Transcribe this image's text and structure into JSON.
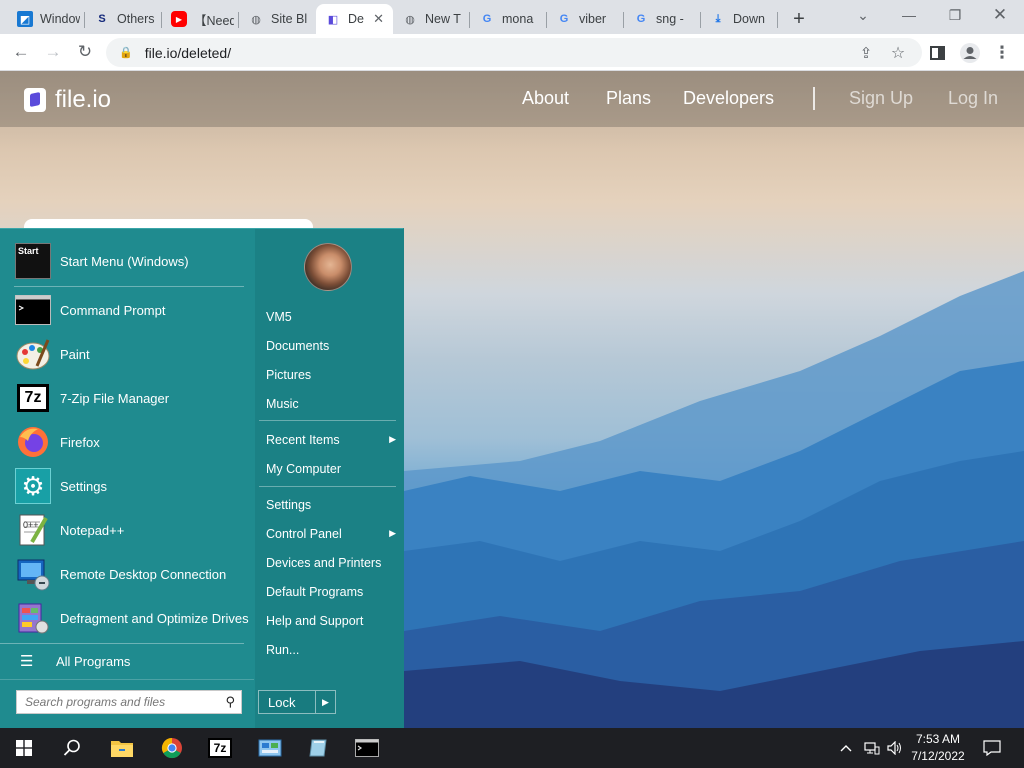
{
  "browser": {
    "tabs": [
      {
        "title": "Windows",
        "icon": "windows-tab-icon",
        "color": "#1778d2"
      },
      {
        "title": "Others",
        "icon": "s-tab-icon",
        "color": "#13287a"
      },
      {
        "title": "【Need",
        "icon": "youtube-tab-icon",
        "color": "#ff0000"
      },
      {
        "title": "Site Bl",
        "icon": "globe-tab-icon",
        "color": "#5f6368"
      },
      {
        "title": "De",
        "icon": "fileio-tab-icon",
        "color": "#5b4bdb"
      },
      {
        "title": "New T",
        "icon": "globe-tab-icon",
        "color": "#5f6368"
      },
      {
        "title": "mona",
        "icon": "google-tab-icon",
        "color": "#4285f4"
      },
      {
        "title": "viber",
        "icon": "google-tab-icon",
        "color": "#4285f4"
      },
      {
        "title": "sng -",
        "icon": "google-tab-icon",
        "color": "#4285f4"
      },
      {
        "title": "Down",
        "icon": "download-tab-icon",
        "color": "#1a73e8"
      }
    ],
    "active_tab_index": 4,
    "url": "file.io/deleted/"
  },
  "site": {
    "logo_text": "file.io",
    "nav": {
      "about": "About",
      "plans": "Plans",
      "developers": "Developers",
      "sign_up": "Sign Up",
      "log_in": "Log In"
    }
  },
  "start_menu": {
    "programs": [
      {
        "label": "Start Menu (Windows)",
        "icon": "start-menu-icon"
      },
      {
        "label": "Command Prompt",
        "icon": "command-prompt-icon"
      },
      {
        "label": "Paint",
        "icon": "paint-icon"
      },
      {
        "label": "7-Zip File Manager",
        "icon": "7zip-icon"
      },
      {
        "label": "Firefox",
        "icon": "firefox-icon"
      },
      {
        "label": "Settings",
        "icon": "settings-gear-icon"
      },
      {
        "label": "Notepad++",
        "icon": "notepad-plus-plus-icon"
      },
      {
        "label": "Remote Desktop Connection",
        "icon": "remote-desktop-icon"
      },
      {
        "label": "Defragment and Optimize Drives",
        "icon": "defragment-icon"
      }
    ],
    "start_tile_text": "Start",
    "all_programs": "All Programs",
    "search_placeholder": "Search programs and files",
    "right_items": [
      {
        "label": "VM5"
      },
      {
        "label": "Documents"
      },
      {
        "label": "Pictures"
      },
      {
        "label": "Music"
      },
      {
        "label": "Recent Items",
        "submenu": true
      },
      {
        "label": "My Computer"
      },
      {
        "label": "Settings"
      },
      {
        "label": "Control Panel",
        "submenu": true
      },
      {
        "label": "Devices and Printers"
      },
      {
        "label": "Default Programs"
      },
      {
        "label": "Help and Support"
      },
      {
        "label": "Run..."
      }
    ],
    "lock_label": "Lock"
  },
  "taskbar": {
    "pinned": [
      "windows-start-icon",
      "search-icon",
      "file-explorer-icon",
      "chrome-icon",
      "7zip-taskbar-icon",
      "control-panel-icon",
      "unknown-app-icon",
      "command-prompt-taskbar-icon"
    ],
    "seven_zip_text": "7z",
    "clock_time": "7:53 AM",
    "clock_date": "7/12/2022"
  }
}
